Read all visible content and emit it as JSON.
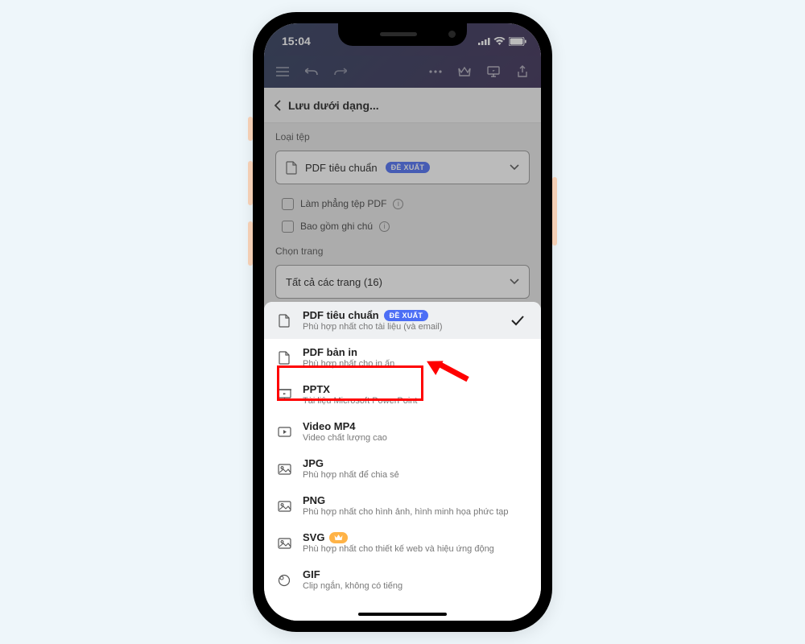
{
  "status": {
    "time": "15:04"
  },
  "header": {
    "title": "Lưu dưới dạng..."
  },
  "sections": {
    "filetype_label": "Loại tệp",
    "page_label": "Chọn trang"
  },
  "filetype_select": {
    "value": "PDF tiêu chuẩn",
    "badge": "ĐỀ XUẤT"
  },
  "checkboxes": {
    "flatten": "Làm phẳng tệp PDF",
    "notes": "Bao gồm ghi chú"
  },
  "page_select": {
    "value": "Tất cả các trang (16)"
  },
  "options": [
    {
      "title": "PDF tiêu chuẩn",
      "sub": "Phù hợp nhất cho tài liệu (và email)",
      "badge": "ĐỀ XUẤT",
      "selected": true,
      "icon": "doc"
    },
    {
      "title": "PDF bản in",
      "sub": "Phù hợp nhất cho in ấn",
      "icon": "doc"
    },
    {
      "title": "PPTX",
      "sub": "Tài liệu Microsoft PowerPoint",
      "icon": "present"
    },
    {
      "title": "Video MP4",
      "sub": "Video chất lượng cao",
      "icon": "video"
    },
    {
      "title": "JPG",
      "sub": "Phù hợp nhất để chia sẻ",
      "icon": "image"
    },
    {
      "title": "PNG",
      "sub": "Phù hợp nhất cho hình ảnh, hình minh họa phức tạp",
      "icon": "image"
    },
    {
      "title": "SVG",
      "sub": "Phù hợp nhất cho thiết kế web và hiệu ứng động",
      "premium": true,
      "icon": "image"
    },
    {
      "title": "GIF",
      "sub": "Clip ngắn, không có tiếng",
      "icon": "gif"
    }
  ]
}
